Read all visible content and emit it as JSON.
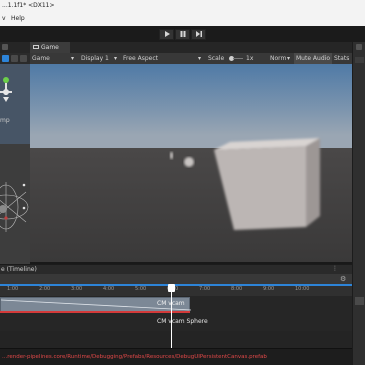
{
  "window": {
    "title": "...1.1f1* <DX11>"
  },
  "menu": {
    "items": [
      "v",
      "Help"
    ]
  },
  "toolbar": {
    "play_icon": "play-icon",
    "pause_icon": "pause-icon",
    "step_icon": "step-icon"
  },
  "scene": {
    "label": "mp"
  },
  "game": {
    "tab_label": "Game",
    "mode": "Game",
    "display": "Display 1",
    "aspect": "Free Aspect",
    "scale_label": "Scale",
    "scale_value": "1x",
    "norm_label": "Norm",
    "mute_audio": "Mute Audio",
    "stats": "Stats"
  },
  "timeline": {
    "title": "e (Timeline)",
    "clip1_label": "CM vcam",
    "clip2_label": "CM vcam Sphere",
    "ruler_marks": [
      "1:00",
      "2:00",
      "3:00",
      "4:00",
      "5:00",
      "6:00",
      "7:00",
      "8:00",
      "9:00",
      "10:00"
    ]
  },
  "status": {
    "message": "...render-pipelines.core/Runtime/Debugging/Prefabs/Resources/DebugUIPersistentCanvas.prefab"
  },
  "colors": {
    "accent": "#2d84d8",
    "error": "#e04848",
    "clip": "#7c8896",
    "clip_bar": "#d33a3a",
    "sky_top": "#5a7fa4",
    "ground": "#3b3b3b"
  }
}
